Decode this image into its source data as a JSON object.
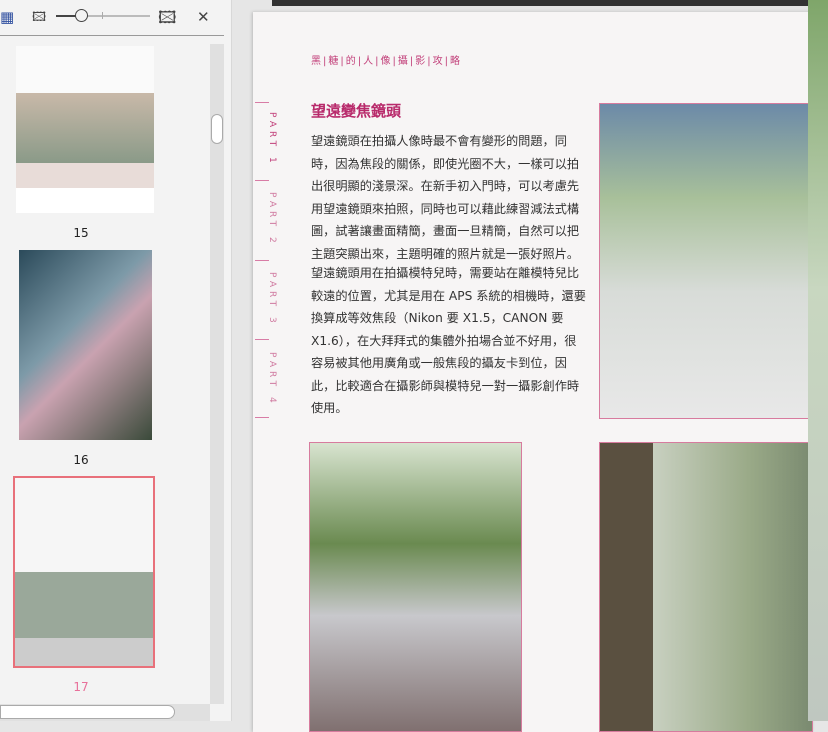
{
  "toolbar": {
    "icons": [
      "thumbnail-view-icon",
      "small-image-icon",
      "large-image-icon",
      "close-icon"
    ],
    "zoom_level_percent": 25
  },
  "thumbnails": [
    {
      "page": "15"
    },
    {
      "page": "16"
    },
    {
      "page": "17",
      "selected": true
    }
  ],
  "accent": "#e8707a",
  "document": {
    "series": "黑|糖|的|人|像|攝|影|攻|略",
    "parts": [
      "PART 1",
      "PART 2",
      "PART 3",
      "PART 4"
    ],
    "heading": "望遠變焦鏡頭",
    "paragraph1": "望遠鏡頭在拍攝人像時最不會有變形的問題，同時，因為焦段的關係，即使光圈不大，一樣可以拍出很明顯的淺景深。在新手初入門時，可以考慮先用望遠鏡頭來拍照，同時也可以藉此練習減法式構圖，試著讓畫面精簡，畫面一旦精簡，自然可以把主題突顯出來，主題明確的照片就是一張好照片。",
    "paragraph2": "望遠鏡頭用在拍攝模特兒時，需要站在離模特兒比較遠的位置，尤其是用在 APS 系統的相機時，還要換算成等效焦段（Nikon 要 X1.5，CANON 要 X1.6），在大拜拜式的集體外拍場合並不好用，很容易被其他用廣角或一般焦段的攝友卡到位，因此，比較適合在攝影師與模特兒一對一攝影創作時使用。"
  }
}
